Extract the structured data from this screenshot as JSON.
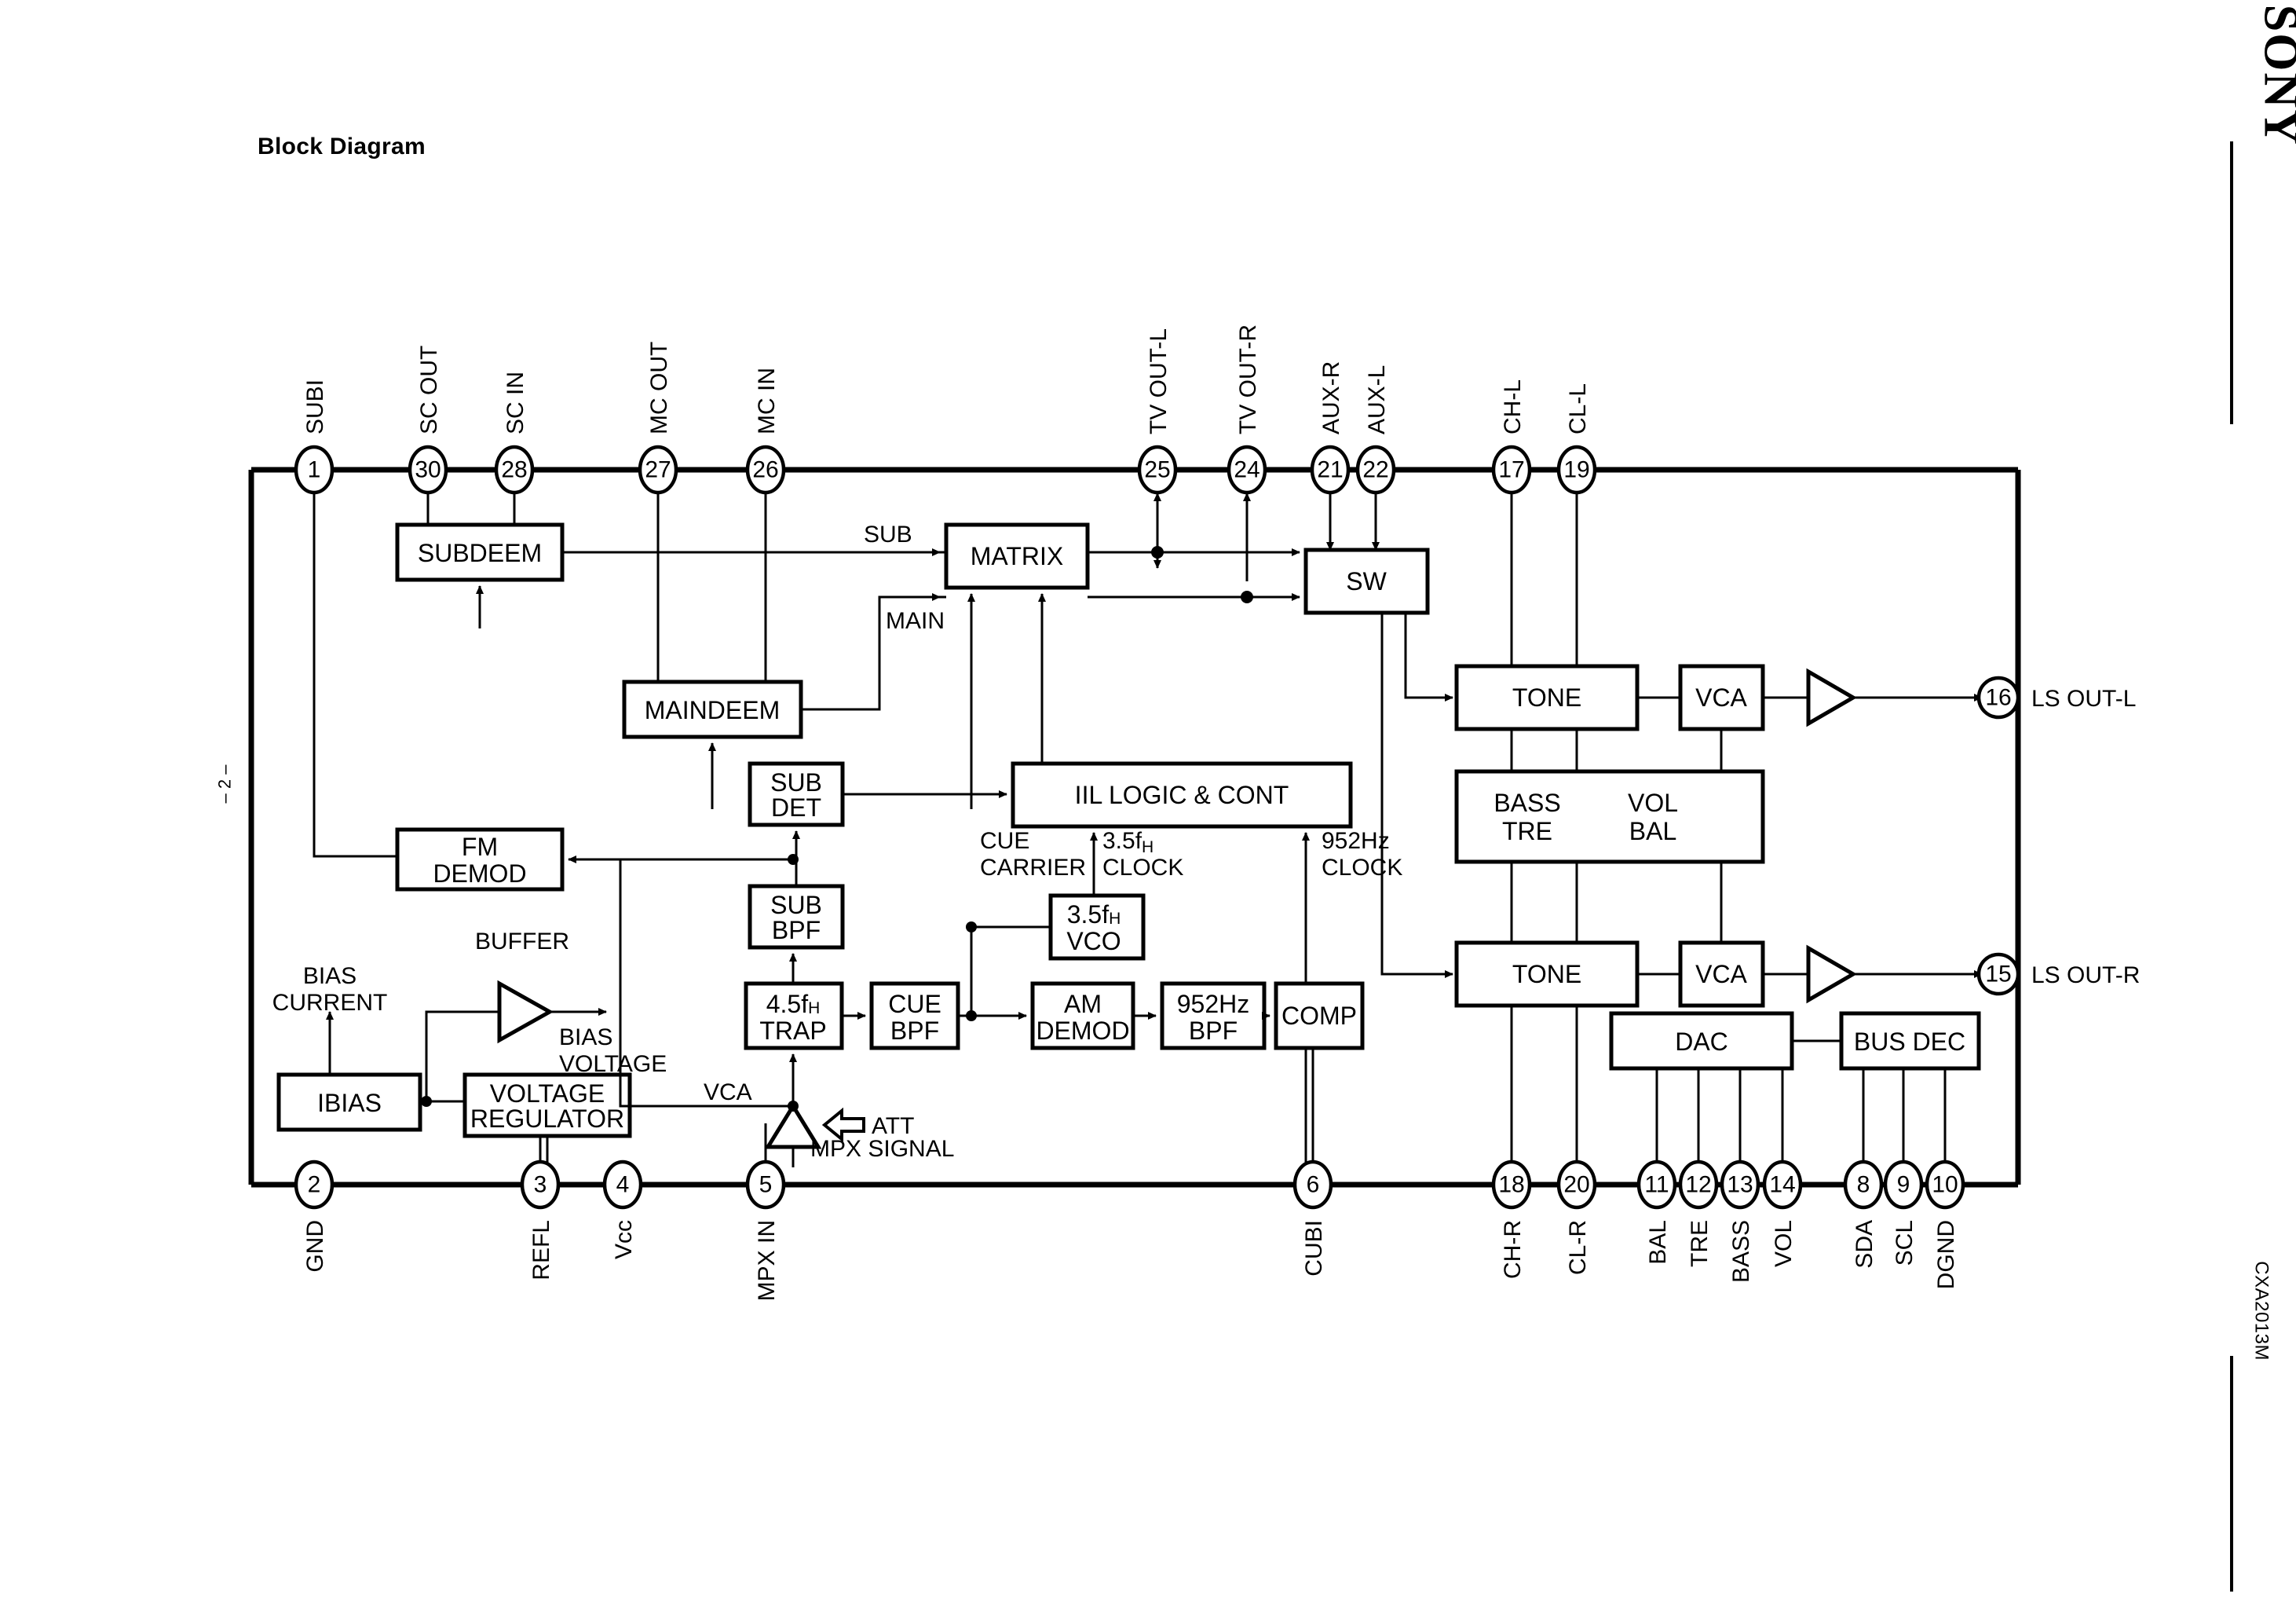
{
  "document": {
    "title": "Block Diagram",
    "brand": "SONY",
    "part_number": "CXA2013M",
    "page_number": "– 2 –"
  },
  "pins_top": [
    {
      "number": "1",
      "label": "SUBI"
    },
    {
      "number": "30",
      "label": "SC OUT"
    },
    {
      "number": "28",
      "label": "SC IN"
    },
    {
      "number": "27",
      "label": "MC OUT"
    },
    {
      "number": "26",
      "label": "MC IN"
    },
    {
      "number": "25",
      "label": "TV OUT-L"
    },
    {
      "number": "24",
      "label": "TV OUT-R"
    },
    {
      "number": "21",
      "label": "AUX-R"
    },
    {
      "number": "22",
      "label": "AUX-L"
    },
    {
      "number": "17",
      "label": "CH-L"
    },
    {
      "number": "19",
      "label": "CL-L"
    }
  ],
  "pins_bottom": [
    {
      "number": "2",
      "label": "GND"
    },
    {
      "number": "3",
      "label": "REFL"
    },
    {
      "number": "4",
      "label": "Vcc"
    },
    {
      "number": "5",
      "label": "MPX IN"
    },
    {
      "number": "6",
      "label": "CUBI"
    },
    {
      "number": "18",
      "label": "CH-R"
    },
    {
      "number": "20",
      "label": "CL-R"
    },
    {
      "number": "11",
      "label": "BAL"
    },
    {
      "number": "12",
      "label": "TRE"
    },
    {
      "number": "13",
      "label": "BASS"
    },
    {
      "number": "14",
      "label": "VOL"
    },
    {
      "number": "8",
      "label": "SDA"
    },
    {
      "number": "9",
      "label": "SCL"
    },
    {
      "number": "10",
      "label": "DGND"
    }
  ],
  "pins_right": [
    {
      "number": "16",
      "label": "LS OUT-L"
    },
    {
      "number": "15",
      "label": "LS OUT-R"
    }
  ],
  "blocks": [
    {
      "id": "subdeem",
      "label": "SUBDEEM"
    },
    {
      "id": "maindeem",
      "label": "MAINDEEM"
    },
    {
      "id": "fm_demod",
      "line1": "FM",
      "line2": "DEMOD"
    },
    {
      "id": "matrix",
      "label": "MATRIX"
    },
    {
      "id": "sw",
      "label": "SW"
    },
    {
      "id": "sub_det",
      "line1": "SUB",
      "line2": "DET"
    },
    {
      "id": "sub_bpf",
      "line1": "SUB",
      "line2": "BPF"
    },
    {
      "id": "iil_logic",
      "label": "IIL LOGIC & CONT"
    },
    {
      "id": "vco",
      "line1": "3.5f",
      "line1_sub": "H",
      "line2": "VCO"
    },
    {
      "id": "trap",
      "line1": "4.5f",
      "line1_sub": "H",
      "line2": "TRAP"
    },
    {
      "id": "cue_bpf",
      "line1": "CUE",
      "line2": "BPF"
    },
    {
      "id": "am_demod",
      "line1": "AM",
      "line2": "DEMOD"
    },
    {
      "id": "bpf952",
      "line1": "952Hz",
      "line2": "BPF"
    },
    {
      "id": "comp",
      "label": "COMP"
    },
    {
      "id": "tone_l",
      "label": "TONE"
    },
    {
      "id": "tone_r",
      "label": "TONE"
    },
    {
      "id": "vca_l",
      "label": "VCA"
    },
    {
      "id": "vca_r",
      "label": "VCA"
    },
    {
      "id": "bass_vol",
      "c1l1": "BASS",
      "c1l2": "TRE",
      "c2l1": "VOL",
      "c2l2": "BAL"
    },
    {
      "id": "dac",
      "label": "DAC"
    },
    {
      "id": "bus_dec",
      "label": "BUS DEC"
    },
    {
      "id": "ibias",
      "label": "IBIAS"
    },
    {
      "id": "vreg",
      "line1": "VOLTAGE",
      "line2": "REGULATOR"
    }
  ],
  "signal_labels": {
    "sub": "SUB",
    "main": "MAIN",
    "cue_carrier_l1": "CUE",
    "cue_carrier_l2": "CARRIER",
    "clock35_l1": "3.5f",
    "clock35_sub": "H",
    "clock35_l2": "CLOCK",
    "clock952_l1": "952Hz",
    "clock952_l2": "CLOCK",
    "bias_current_l1": "BIAS",
    "bias_current_l2": "CURRENT",
    "bias_voltage_l1": "BIAS",
    "bias_voltage_l2": "VOLTAGE",
    "buffer": "BUFFER",
    "vca_att": "VCA",
    "att": "ATT",
    "mpx_signal": "MPX SIGNAL"
  }
}
